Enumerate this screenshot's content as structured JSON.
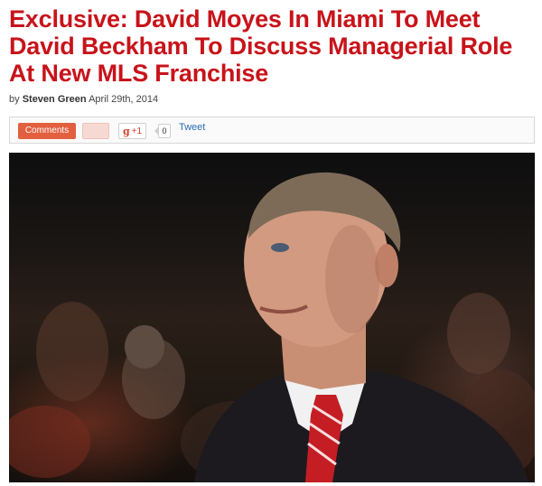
{
  "article": {
    "headline": "Exclusive: David Moyes In Miami To Meet David Beckham To Discuss Managerial Role At New MLS Franchise",
    "byline_prefix": "by",
    "author": "Steven Green",
    "date": "April 29th, 2014"
  },
  "social": {
    "comments_label": "Comments",
    "gplus_label": "+1",
    "gplus_icon": "g",
    "gplus_count": "0",
    "tweet_label": "Tweet"
  },
  "photo": {
    "icon": "photo-of-man-in-suit"
  },
  "colors": {
    "headline": "#c8131a",
    "comments_button": "#e2603f",
    "tie_red": "#c41e24"
  }
}
